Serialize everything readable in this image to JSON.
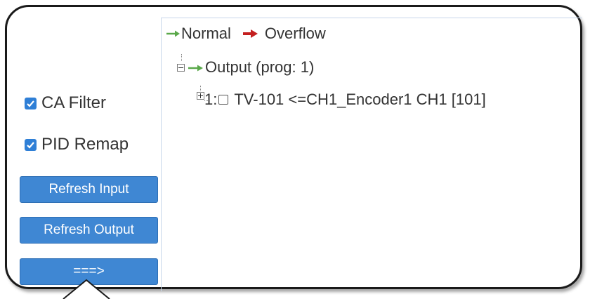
{
  "options": {
    "ca_filter": {
      "label": "CA Filter",
      "checked": true
    },
    "pid_remap": {
      "label": "PID Remap",
      "checked": true
    }
  },
  "buttons": {
    "refresh_input": "Refresh Input",
    "refresh_output": "Refresh Output",
    "transfer": "===>"
  },
  "legend": {
    "normal": {
      "label": "Normal",
      "color": "#5aa84a",
      "icon": "green-arrow"
    },
    "overflow": {
      "label": "Overflow",
      "color": "#c41f1f",
      "icon": "red-arrow"
    }
  },
  "tree": {
    "root": {
      "label": "Output (prog: 1)",
      "expanded": true,
      "icon": "green-arrow"
    },
    "children": [
      {
        "label": "1: ",
        "name": "TV-101 <=CH1_Encoder1 CH1 [101]",
        "expanded": false,
        "checked": false
      }
    ]
  },
  "colors": {
    "accent": "#3f87d3",
    "checkbox": "#2f7fd6"
  }
}
